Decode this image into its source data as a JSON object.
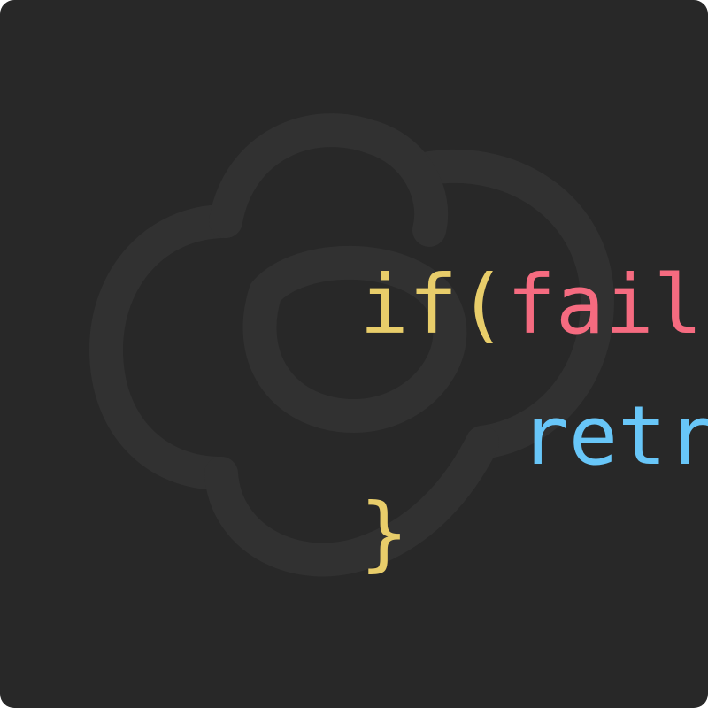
{
  "colors": {
    "background": "#282828",
    "watermark": "#313131",
    "keyword": "#e8cd6a",
    "condition": "#f56b80",
    "function_name": "#68c6f8",
    "call_parens": "#f078bc",
    "semicolon": "#5f6772"
  },
  "watermark": {
    "icon": "cloud-loop-icon"
  },
  "code": {
    "line1": {
      "keyword": "if",
      "open_paren": "(",
      "condition": "fail",
      "close_paren": ")",
      "open_brace": "{"
    },
    "line2": {
      "function_name": "retry",
      "parens": "()",
      "semicolon": ";"
    },
    "line3": {
      "close_brace": "}"
    }
  }
}
